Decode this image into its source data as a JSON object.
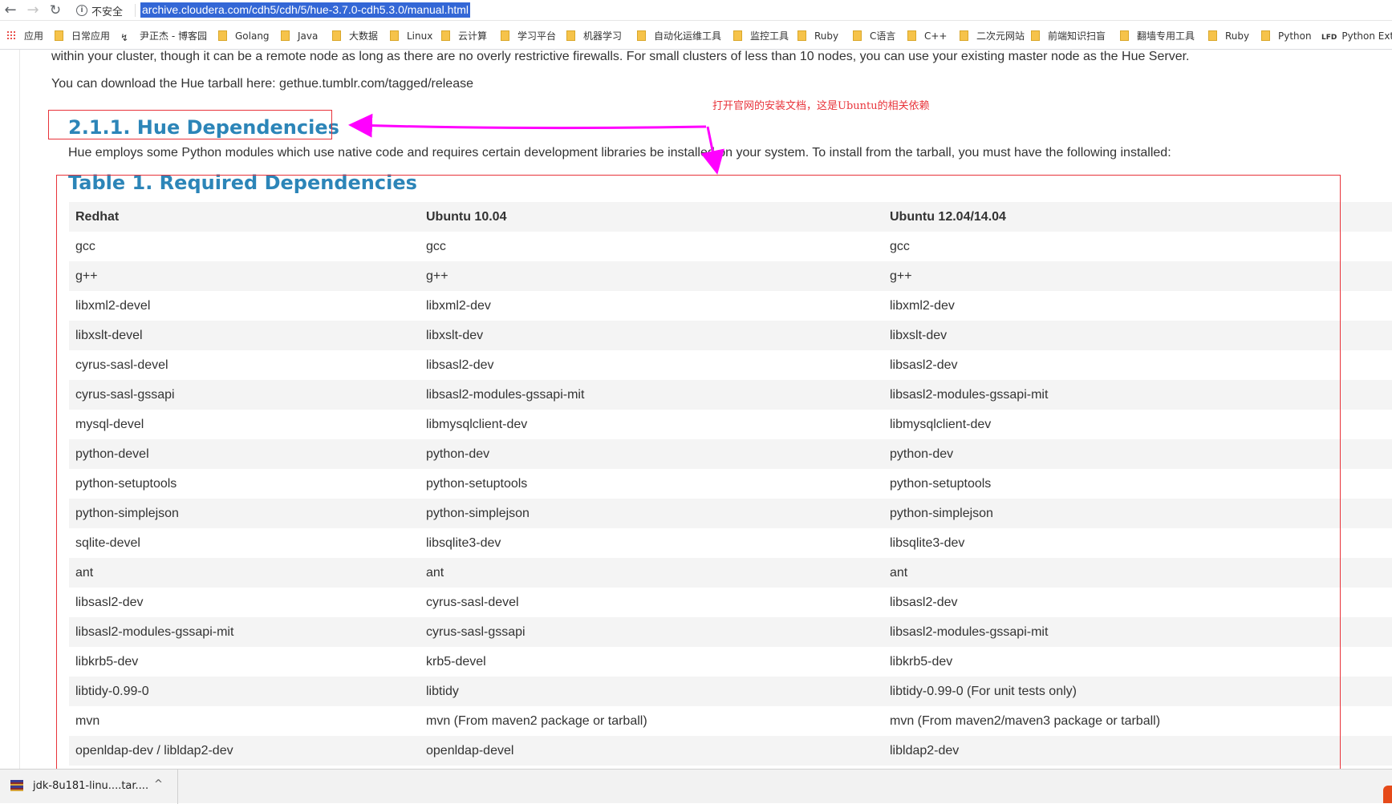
{
  "browser": {
    "security_label": "不安全",
    "url": "archive.cloudera.com/cdh5/cdh/5/hue-3.7.0-cdh5.3.0/manual.html",
    "bookmarks": [
      {
        "label": "应用",
        "icon": "apps-grid-icon"
      },
      {
        "label": "日常应用",
        "icon": "folder-icon"
      },
      {
        "label": "尹正杰 - 博客园",
        "icon": "site-icon"
      },
      {
        "label": "Golang",
        "icon": "folder-icon"
      },
      {
        "label": "Java",
        "icon": "folder-icon"
      },
      {
        "label": "大数据",
        "icon": "folder-icon"
      },
      {
        "label": "Linux",
        "icon": "folder-icon"
      },
      {
        "label": "云计算",
        "icon": "folder-icon"
      },
      {
        "label": "学习平台",
        "icon": "folder-icon"
      },
      {
        "label": "机器学习",
        "icon": "folder-icon"
      },
      {
        "label": "自动化运维工具",
        "icon": "folder-icon"
      },
      {
        "label": "监控工具",
        "icon": "folder-icon"
      },
      {
        "label": "Ruby",
        "icon": "folder-icon"
      },
      {
        "label": "C语言",
        "icon": "folder-icon"
      },
      {
        "label": "C++",
        "icon": "folder-icon"
      },
      {
        "label": "二次元网站",
        "icon": "folder-icon"
      },
      {
        "label": "前端知识扫盲",
        "icon": "folder-icon"
      },
      {
        "label": "翻墙专用工具",
        "icon": "folder-icon"
      },
      {
        "label": "Ruby",
        "icon": "folder-icon"
      },
      {
        "label": "Python",
        "icon": "folder-icon"
      },
      {
        "label": "Python Exte",
        "icon": "lfd-icon",
        "icon_text": "LFD"
      }
    ]
  },
  "page": {
    "para_cluster": "within your cluster, though it can be a remote node as long as there are no overly restrictive firewalls. For small clusters of less than 10 nodes, you can use your existing master node as the Hue Server.",
    "para_download": "You can download the Hue tarball here: gethue.tumblr.com/tagged/release",
    "section_heading": "2.1.1. Hue Dependencies",
    "para_intro": "Hue employs some Python modules which use native code and requires certain development libraries be installed on your system. To install from the tarball, you must have the following installed:",
    "table_title": "Table 1. Required Dependencies",
    "table": {
      "headers": [
        "Redhat",
        "Ubuntu 10.04",
        "Ubuntu 12.04/14.04"
      ],
      "rows": [
        [
          "gcc",
          "gcc",
          "gcc"
        ],
        [
          "g++",
          "g++",
          "g++"
        ],
        [
          "libxml2-devel",
          "libxml2-dev",
          "libxml2-dev"
        ],
        [
          "libxslt-devel",
          "libxslt-dev",
          "libxslt-dev"
        ],
        [
          "cyrus-sasl-devel",
          "libsasl2-dev",
          "libsasl2-dev"
        ],
        [
          "cyrus-sasl-gssapi",
          "libsasl2-modules-gssapi-mit",
          "libsasl2-modules-gssapi-mit"
        ],
        [
          "mysql-devel",
          "libmysqlclient-dev",
          "libmysqlclient-dev"
        ],
        [
          "python-devel",
          "python-dev",
          "python-dev"
        ],
        [
          "python-setuptools",
          "python-setuptools",
          "python-setuptools"
        ],
        [
          "python-simplejson",
          "python-simplejson",
          "python-simplejson"
        ],
        [
          "sqlite-devel",
          "libsqlite3-dev",
          "libsqlite3-dev"
        ],
        [
          "ant",
          "ant",
          "ant"
        ],
        [
          "libsasl2-dev",
          "cyrus-sasl-devel",
          "libsasl2-dev"
        ],
        [
          "libsasl2-modules-gssapi-mit",
          "cyrus-sasl-gssapi",
          "libsasl2-modules-gssapi-mit"
        ],
        [
          "libkrb5-dev",
          "krb5-devel",
          "libkrb5-dev"
        ],
        [
          "libtidy-0.99-0",
          "libtidy",
          "libtidy-0.99-0 (For unit tests only)"
        ],
        [
          "mvn",
          "mvn (From maven2 package or tarball)",
          "mvn (From maven2/maven3 package or tarball)"
        ],
        [
          "openldap-dev / libldap2-dev",
          "openldap-devel",
          "libldap2-dev"
        ]
      ]
    }
  },
  "annotation": {
    "text": "打开官网的安装文档，这是Ubuntu的相关依赖",
    "color": "#e8333a",
    "arrow_color": "#ff00ff"
  },
  "downloads": {
    "file_name": "jdk-8u181-linu....tar....",
    "chevron": "^"
  }
}
